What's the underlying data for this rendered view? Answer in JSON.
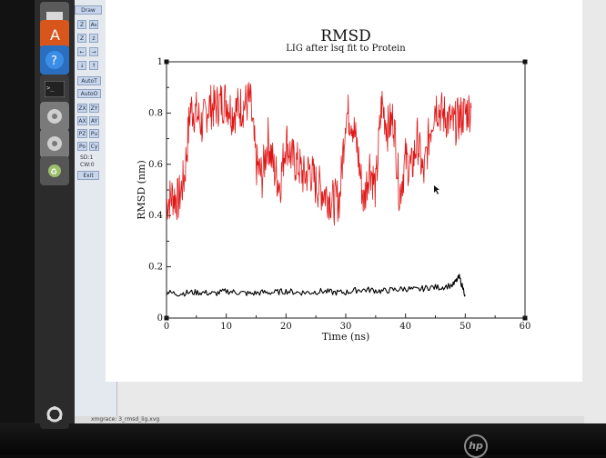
{
  "window": {
    "status_text": "xmgrace: 3_rmsd_lig.xvg"
  },
  "toolbar": {
    "draw": "Draw",
    "zoom_in": "Z",
    "zoom_out": "z",
    "autot": "AutoT",
    "autoo": "AutoO",
    "zx": "ZX",
    "zy": "ZY",
    "ax": "AX",
    "ay": "AY",
    "pz": "PZ",
    "pu": "Pu",
    "po": "Po",
    "cy": "Cy",
    "sd": "SD:1",
    "cw": "CW:0",
    "exit": "Exit"
  },
  "launcher": {
    "icons": [
      "ubuntu-icon",
      "software-center-icon",
      "help-icon",
      "terminal-icon",
      "settings-icon",
      "settings-icon-2",
      "trash-icon",
      "ubuntu-logo-icon"
    ]
  },
  "chart_data": {
    "type": "line",
    "title": "RMSD",
    "subtitle": "LIG after lsq fit to Protein",
    "xlabel": "Time (ns)",
    "ylabel": "RMSD (nm)",
    "xlim": [
      0,
      60
    ],
    "ylim": [
      0,
      1
    ],
    "xticks": [
      0,
      10,
      20,
      30,
      40,
      50,
      60
    ],
    "yticks": [
      0,
      0.2,
      0.4,
      0.6,
      0.8,
      1
    ],
    "grid": false,
    "legend": "none",
    "series": [
      {
        "color": "#e01515",
        "x": [
          0,
          1,
          2,
          3,
          4,
          5,
          6,
          7,
          8,
          9,
          10,
          11,
          12,
          13,
          14,
          15,
          16,
          17,
          18,
          19,
          20,
          21,
          22,
          23,
          24,
          25,
          26,
          27,
          28,
          29,
          30,
          31,
          32,
          33,
          34,
          35,
          36,
          37,
          38,
          39,
          40,
          41,
          42,
          43,
          44,
          45,
          46,
          47,
          48,
          49,
          50,
          51
        ],
        "y": [
          0.45,
          0.48,
          0.46,
          0.55,
          0.82,
          0.8,
          0.75,
          0.83,
          0.82,
          0.84,
          0.85,
          0.8,
          0.82,
          0.83,
          0.85,
          0.6,
          0.55,
          0.7,
          0.58,
          0.52,
          0.7,
          0.62,
          0.6,
          0.55,
          0.58,
          0.52,
          0.5,
          0.48,
          0.45,
          0.47,
          0.8,
          0.78,
          0.65,
          0.45,
          0.6,
          0.5,
          0.84,
          0.74,
          0.78,
          0.48,
          0.62,
          0.58,
          0.7,
          0.55,
          0.72,
          0.84,
          0.8,
          0.78,
          0.75,
          0.78,
          0.8,
          0.82
        ]
      },
      {
        "color": "#000000",
        "x": [
          0,
          2,
          4,
          6,
          8,
          10,
          12,
          14,
          16,
          18,
          20,
          22,
          24,
          26,
          28,
          30,
          32,
          34,
          36,
          38,
          40,
          42,
          44,
          46,
          48,
          49,
          50
        ],
        "y": [
          0.1,
          0.095,
          0.1,
          0.1,
          0.095,
          0.105,
          0.1,
          0.095,
          0.1,
          0.1,
          0.105,
          0.1,
          0.1,
          0.105,
          0.1,
          0.1,
          0.11,
          0.11,
          0.105,
          0.11,
          0.115,
          0.11,
          0.12,
          0.12,
          0.13,
          0.16,
          0.09
        ]
      }
    ]
  }
}
